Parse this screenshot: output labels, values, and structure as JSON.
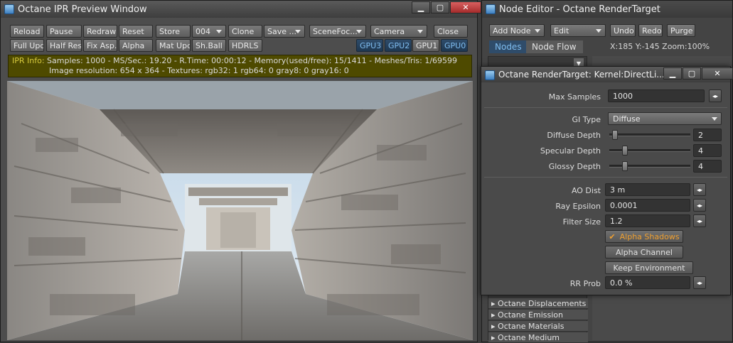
{
  "ipr": {
    "title": "Octane IPR Preview Window",
    "row1": [
      "Reload",
      "Pause",
      "Redraw",
      "Reset",
      "Store",
      "004",
      "Clone",
      "Save ...",
      "SceneFoc...",
      "Camera",
      "Close"
    ],
    "row2": [
      "Full Upd.",
      "Half Res",
      "Fix Asp.",
      "Alpha",
      "Mat Upd",
      "Sh.Ball",
      "HDRLS"
    ],
    "gpus": [
      "GPU3",
      "GPU2",
      "GPU1",
      "GPU0"
    ],
    "info_label": "IPR Info:",
    "info_line1": "Samples: 1000  -  MS/Sec.: 19.20  -  R.Time: 00:00:12 - Memory(used/free): 15/1411  -  Meshes/Tris: 1/69599",
    "info_line2": "Image resolution: 654 x 364 - Textures:  rgb32: 1   rgb64: 0   gray8: 0   gray16: 0"
  },
  "node_editor": {
    "title": "Node Editor - Octane RenderTarget",
    "add_node": "Add Node",
    "edit": "Edit",
    "undo": "Undo",
    "redo": "Redo",
    "purge": "Purge",
    "tab_nodes": "Nodes",
    "tab_nodeflow": "Node Flow",
    "coords": "X:185 Y:-145 Zoom:100%",
    "list": [
      "Octane Displacements",
      "Octane Emission",
      "Octane Materials",
      "Octane Medium"
    ]
  },
  "kernel": {
    "title": "Octane RenderTarget: Kernel:DirectLi...",
    "max_samples_label": "Max Samples",
    "max_samples": "1000",
    "gi_type_label": "GI Type",
    "gi_type": "Diffuse",
    "diffuse_depth_label": "Diffuse Depth",
    "diffuse_depth": "2",
    "specular_depth_label": "Specular Depth",
    "specular_depth": "4",
    "glossy_depth_label": "Glossy Depth",
    "glossy_depth": "4",
    "ao_dist_label": "AO Dist",
    "ao_dist": "3 m",
    "ray_epsilon_label": "Ray Epsilon",
    "ray_epsilon": "0.0001",
    "filter_size_label": "Filter Size",
    "filter_size": "1.2",
    "alpha_shadows": "Alpha Shadows",
    "alpha_channel": "Alpha Channel",
    "keep_environment": "Keep Environment",
    "rr_prob_label": "RR Prob",
    "rr_prob": "0.0 %"
  }
}
